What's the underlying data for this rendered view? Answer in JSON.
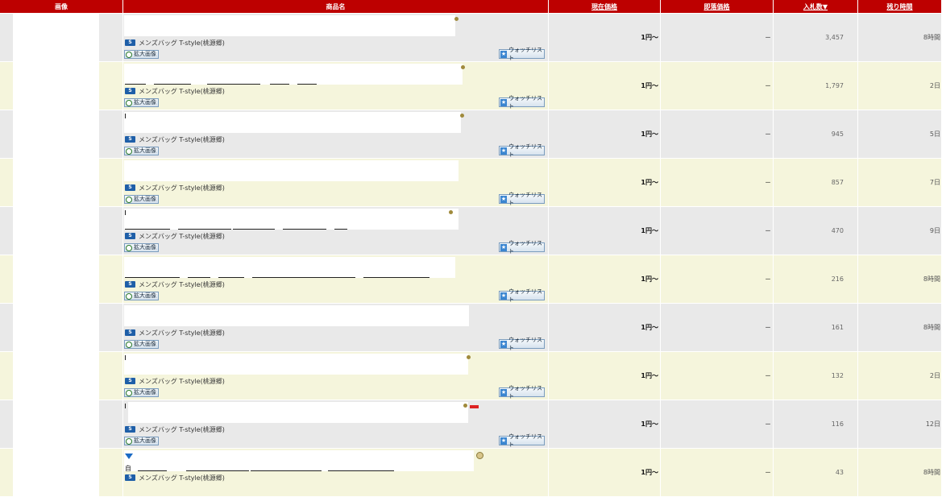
{
  "header": {
    "image": "画像",
    "name": "商品名",
    "current_price": "現在価格",
    "buy_now": "即落価格",
    "bids": "入札数▼",
    "time_left": "残り時間"
  },
  "labels": {
    "zoom": "拡大画像",
    "watchlist": "ウォッチリスト",
    "store_icon": "S"
  },
  "rows": [
    {
      "seller": "メンズバッグ T-style(桃源郷)",
      "price": "1円～",
      "buy_now": "－",
      "bids": "3,457",
      "time": "8時間"
    },
    {
      "seller": "メンズバッグ T-style(桃源郷)",
      "price": "1円～",
      "buy_now": "－",
      "bids": "1,797",
      "time": "2日"
    },
    {
      "seller": "メンズバッグ T-style(桃源郷)",
      "price": "1円～",
      "buy_now": "－",
      "bids": "945",
      "time": "5日"
    },
    {
      "seller": "メンズバッグ T-style(桃源郷)",
      "price": "1円～",
      "buy_now": "－",
      "bids": "857",
      "time": "7日"
    },
    {
      "seller": "メンズバッグ T-style(桃源郷)",
      "price": "1円～",
      "buy_now": "－",
      "bids": "470",
      "time": "9日"
    },
    {
      "seller": "メンズバッグ T-style(桃源郷)",
      "price": "1円～",
      "buy_now": "－",
      "bids": "216",
      "time": "8時間"
    },
    {
      "seller": "メンズバッグ T-style(桃源郷)",
      "price": "1円～",
      "buy_now": "－",
      "bids": "161",
      "time": "8時間"
    },
    {
      "seller": "メンズバッグ T-style(桃源郷)",
      "price": "1円～",
      "buy_now": "－",
      "bids": "132",
      "time": "2日"
    },
    {
      "seller": "メンズバッグ T-style(桃源郷)",
      "price": "1円～",
      "buy_now": "－",
      "bids": "116",
      "time": "12日"
    },
    {
      "seller": "メンズバッグ T-style(桃源郷)",
      "price": "1円～",
      "buy_now": "－",
      "bids": "43",
      "time": "8時間",
      "title_start": "自"
    }
  ],
  "colors": {
    "header_bg": "#bd0000",
    "row_gray": "#e9e9e9",
    "row_cream": "#f5f5dc"
  }
}
